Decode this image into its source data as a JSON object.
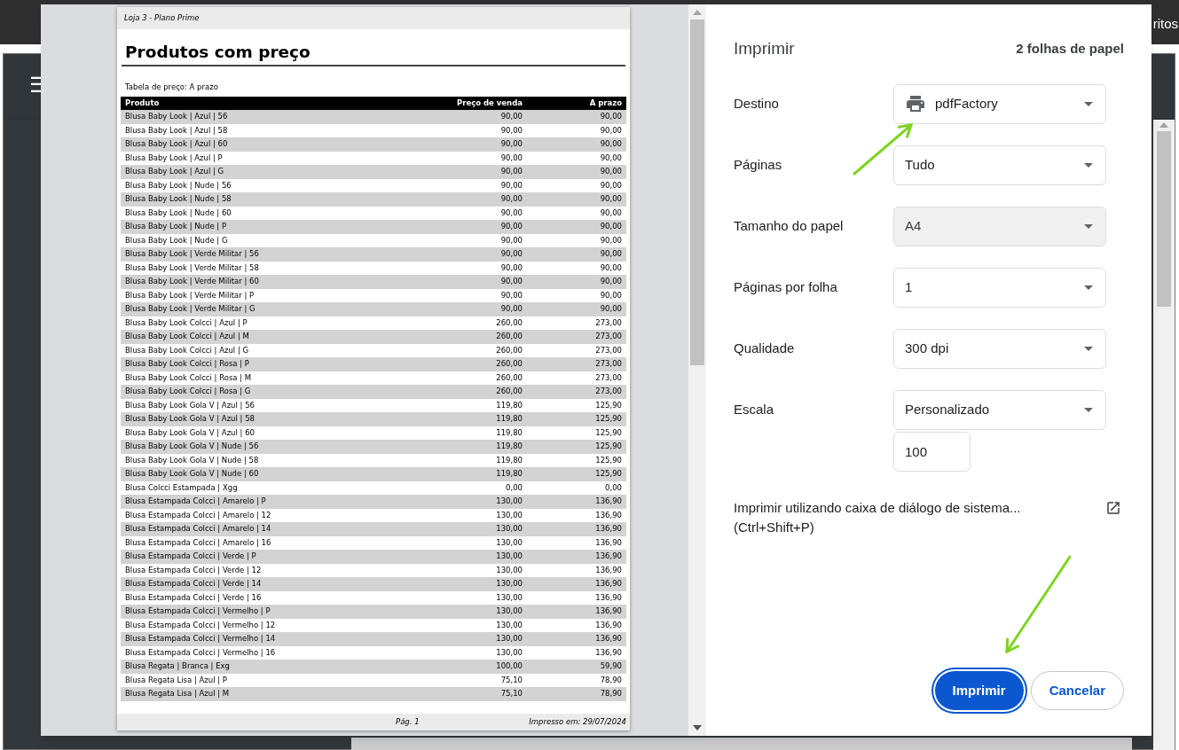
{
  "background": {
    "top_bar_right": "ritos",
    "menu_icon": "☰"
  },
  "preview": {
    "header": "Loja 3 - Plano Prime",
    "title": "Produtos com preço",
    "subtitle": "Tabela de preço: A prazo",
    "columns": [
      "Produto",
      "Preço de venda",
      "A prazo"
    ],
    "rows": [
      [
        "Blusa Baby Look | Azul | 56",
        "90,00",
        "90,00"
      ],
      [
        "Blusa Baby Look | Azul | 58",
        "90,00",
        "90,00"
      ],
      [
        "Blusa Baby Look | Azul | 60",
        "90,00",
        "90,00"
      ],
      [
        "Blusa Baby Look | Azul | P",
        "90,00",
        "90,00"
      ],
      [
        "Blusa Baby Look | Azul | G",
        "90,00",
        "90,00"
      ],
      [
        "Blusa Baby Look | Nude | 56",
        "90,00",
        "90,00"
      ],
      [
        "Blusa Baby Look | Nude | 58",
        "90,00",
        "90,00"
      ],
      [
        "Blusa Baby Look | Nude | 60",
        "90,00",
        "90,00"
      ],
      [
        "Blusa Baby Look | Nude | P",
        "90,00",
        "90,00"
      ],
      [
        "Blusa Baby Look | Nude | G",
        "90,00",
        "90,00"
      ],
      [
        "Blusa Baby Look | Verde Militar | 56",
        "90,00",
        "90,00"
      ],
      [
        "Blusa Baby Look | Verde Militar | 58",
        "90,00",
        "90,00"
      ],
      [
        "Blusa Baby Look | Verde Militar | 60",
        "90,00",
        "90,00"
      ],
      [
        "Blusa Baby Look | Verde Militar | P",
        "90,00",
        "90,00"
      ],
      [
        "Blusa Baby Look | Verde Militar | G",
        "90,00",
        "90,00"
      ],
      [
        "Blusa Baby Look Colcci | Azul | P",
        "260,00",
        "273,00"
      ],
      [
        "Blusa Baby Look Colcci | Azul | M",
        "260,00",
        "273,00"
      ],
      [
        "Blusa Baby Look Colcci | Azul | G",
        "260,00",
        "273,00"
      ],
      [
        "Blusa Baby Look Colcci | Rosa | P",
        "260,00",
        "273,00"
      ],
      [
        "Blusa Baby Look Colcci | Rosa | M",
        "260,00",
        "273,00"
      ],
      [
        "Blusa Baby Look Colcci | Rosa | G",
        "260,00",
        "273,00"
      ],
      [
        "Blusa Baby Look Gola V | Azul | 56",
        "119,80",
        "125,90"
      ],
      [
        "Blusa Baby Look Gola V | Azul | 58",
        "119,80",
        "125,90"
      ],
      [
        "Blusa Baby Look Gola V | Azul | 60",
        "119,80",
        "125,90"
      ],
      [
        "Blusa Baby Look Gola V | Nude | 56",
        "119,80",
        "125,90"
      ],
      [
        "Blusa Baby Look Gola V | Nude | 58",
        "119,80",
        "125,90"
      ],
      [
        "Blusa Baby Look Gola V | Nude | 60",
        "119,80",
        "125,90"
      ],
      [
        "Blusa Colcci Estampada | Xgg",
        "0,00",
        "0,00"
      ],
      [
        "Blusa Estampada Colcci | Amarelo | P",
        "130,00",
        "136,90"
      ],
      [
        "Blusa Estampada Colcci | Amarelo | 12",
        "130,00",
        "136,90"
      ],
      [
        "Blusa Estampada Colcci | Amarelo | 14",
        "130,00",
        "136,90"
      ],
      [
        "Blusa Estampada Colcci | Amarelo | 16",
        "130,00",
        "136,90"
      ],
      [
        "Blusa Estampada Colcci | Verde | P",
        "130,00",
        "136,90"
      ],
      [
        "Blusa Estampada Colcci | Verde | 12",
        "130,00",
        "136,90"
      ],
      [
        "Blusa Estampada Colcci | Verde | 14",
        "130,00",
        "136,90"
      ],
      [
        "Blusa Estampada Colcci | Verde | 16",
        "130,00",
        "136,90"
      ],
      [
        "Blusa Estampada Colcci | Vermelho | P",
        "130,00",
        "136,90"
      ],
      [
        "Blusa Estampada Colcci | Vermelho | 12",
        "130,00",
        "136,90"
      ],
      [
        "Blusa Estampada Colcci | Vermelho | 14",
        "130,00",
        "136,90"
      ],
      [
        "Blusa Estampada Colcci | Vermelho | 16",
        "130,00",
        "136,90"
      ],
      [
        "Blusa Regata | Branca | Exg",
        "100,00",
        "59,90"
      ],
      [
        "Blusa Regata Lisa | Azul | P",
        "75,10",
        "78,90"
      ],
      [
        "Blusa Regata Lisa | Azul | M",
        "75,10",
        "78,90"
      ]
    ],
    "footer_page": "Pág. 1",
    "footer_printed": "Impresso em: 29/07/2024"
  },
  "print_dialog": {
    "title": "Imprimir",
    "sheets": "2 folhas de papel",
    "settings": [
      {
        "kind": "printer_select",
        "label": "Destino",
        "value": "pdfFactory",
        "disabled": false
      },
      {
        "kind": "select",
        "label": "Páginas",
        "value": "Tudo",
        "disabled": false
      },
      {
        "kind": "select",
        "label": "Tamanho do papel",
        "value": "A4",
        "disabled": true
      },
      {
        "kind": "select",
        "label": "Páginas por folha",
        "value": "1",
        "disabled": false
      },
      {
        "kind": "select",
        "label": "Qualidade",
        "value": "300 dpi",
        "disabled": false
      },
      {
        "kind": "select_with_input",
        "label": "Escala",
        "value": "Personalizado",
        "input_value": "100",
        "disabled": false
      }
    ],
    "system_dialog_link": "Imprimir utilizando caixa de diálogo de sistema...",
    "system_dialog_shortcut": "(Ctrl+Shift+P)",
    "buttons": [
      {
        "kind": "primary",
        "label": "Imprimir"
      },
      {
        "kind": "secondary",
        "label": "Cancelar"
      }
    ]
  }
}
